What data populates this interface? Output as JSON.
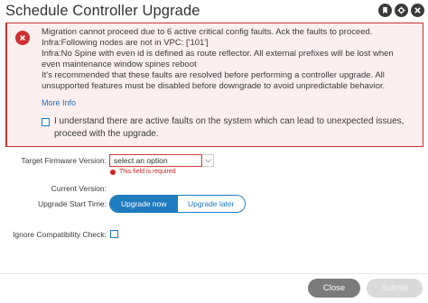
{
  "dialog": {
    "title": "Schedule Controller Upgrade",
    "header_icons": [
      "bookmark-icon",
      "settings-icon",
      "close-icon"
    ]
  },
  "alert": {
    "icon": "close-icon",
    "lines": [
      "Migration cannot proceed due to 6 active critical config faults. Ack the faults to proceed.",
      "Infra:Following nodes are not in VPC: ['101']",
      "Infra:No Spine with even id is defined as route reflector. All external prefixes will be lost when",
      "even maintenance window spines reboot",
      "It's recommended that these faults are resolved before performing a controller upgrade. All",
      "unsupported features must be disabled before downgrade to avoid unpredictable behavior."
    ],
    "more_info": "More Info",
    "ack_text": "I understand there are active faults on the system which can lead to unexpected issues, proceed with the upgrade.",
    "ack_checked": false
  },
  "form": {
    "target_firmware": {
      "label": "Target Firmware Version:",
      "value": "select an option",
      "error": "This field is required"
    },
    "current_version": {
      "label": "Current Version:",
      "value": ""
    },
    "upgrade_start_time": {
      "label": "Upgrade Start Time:",
      "options": [
        "Upgrade now",
        "Upgrade later"
      ],
      "selected": "Upgrade now"
    },
    "ignore_compat": {
      "label": "Ignore Compatibility Check:",
      "checked": false
    }
  },
  "footer": {
    "close_label": "Close",
    "submit_label": "Submit"
  },
  "colors": {
    "accent": "#1e7bbf",
    "error": "#cf2f2f",
    "alert_bg": "#fcefef"
  }
}
